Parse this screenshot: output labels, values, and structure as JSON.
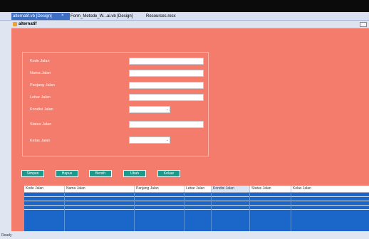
{
  "tabs": [
    {
      "label": "alternatif.vb [Design]",
      "active": true
    },
    {
      "label": "Form_Metode_W...ai.vb [Design]",
      "active": false
    },
    {
      "label": "Resources.resx",
      "active": false
    }
  ],
  "tab_close": "×",
  "form": {
    "title": "alternatif",
    "back_color": "#f47c6d"
  },
  "fields": [
    {
      "label": "Kode Jalan",
      "kind": "text"
    },
    {
      "label": "Nama Jalan",
      "kind": "text"
    },
    {
      "label": "Panjang Jalan",
      "kind": "text"
    },
    {
      "label": "Lebar Jalan",
      "kind": "text"
    },
    {
      "label": "Kondisi Jalan",
      "kind": "combo"
    },
    {
      "label": "Status Jalan",
      "kind": "text"
    },
    {
      "label": "Kelas Jalan",
      "kind": "combo"
    }
  ],
  "combo_arrow": "⌄",
  "buttons": [
    "Simpan",
    "Hapus",
    "Bersih",
    "Ubah",
    "Keluar"
  ],
  "grid": {
    "columns": [
      "Kode Jalan",
      "Nama Jalan",
      "Panjang Jalan",
      "Lebar Jalan",
      "Kondisi Jalan",
      "Status Jalan",
      "Kelas Jalan"
    ],
    "selected_column": 4,
    "row_color": "#1a66c9"
  },
  "status": "Ready"
}
